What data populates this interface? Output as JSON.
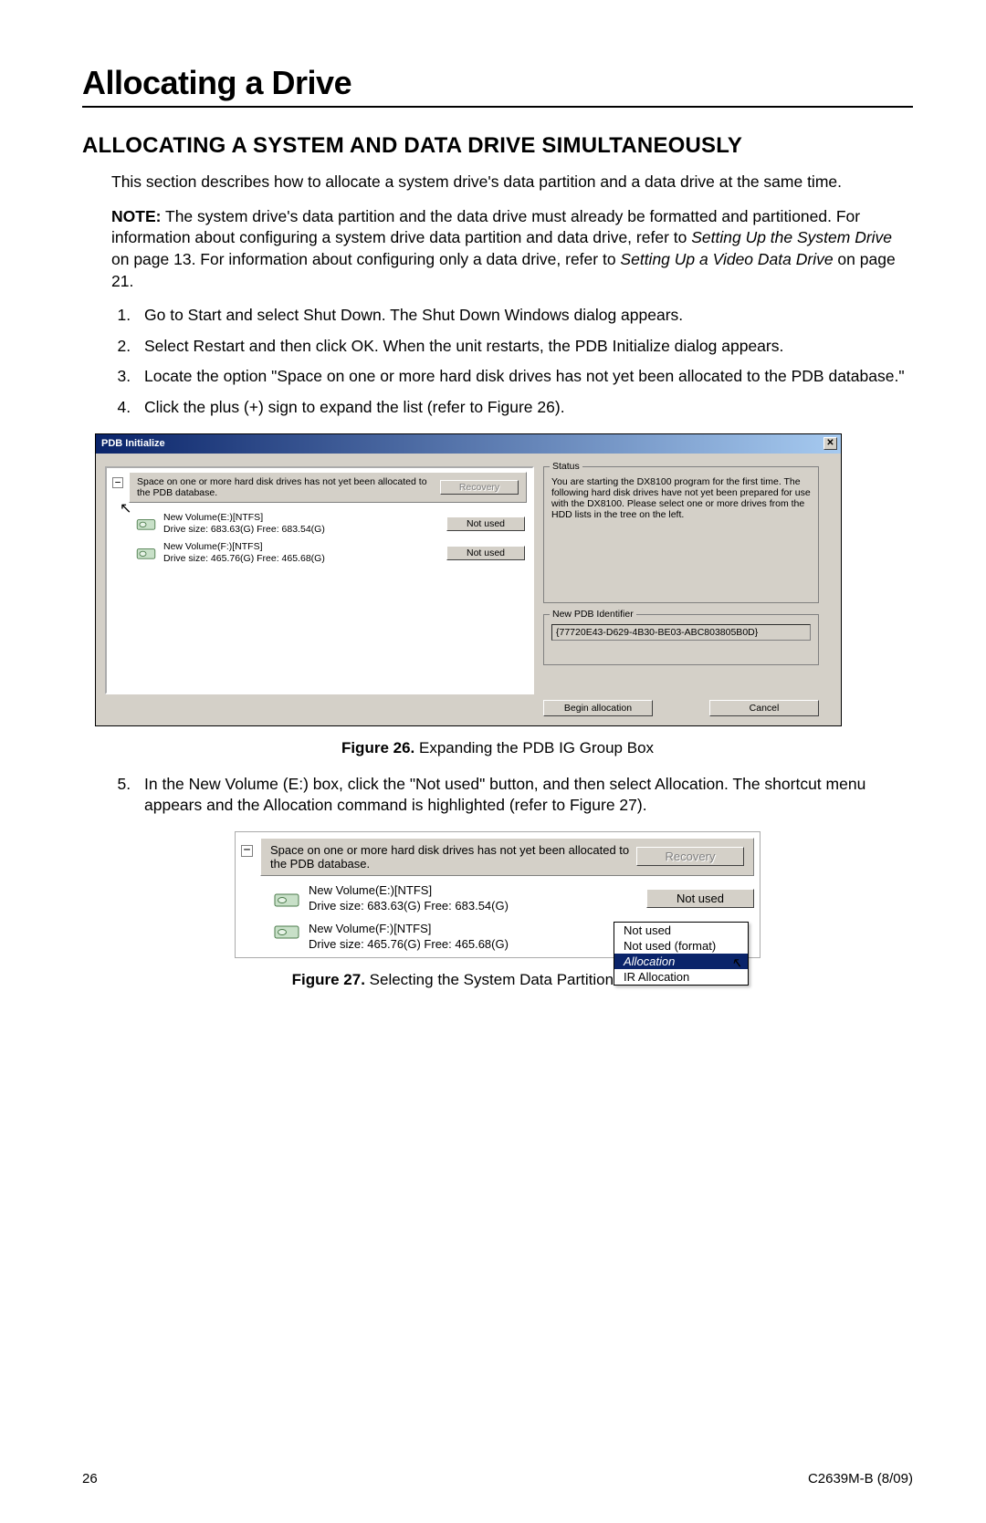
{
  "heading": "Allocating a Drive",
  "section": "ALLOCATING A SYSTEM AND DATA DRIVE SIMULTANEOUSLY",
  "intro": "This section describes how to allocate a system drive's data partition and a data drive at the same time.",
  "note_label": "NOTE:",
  "note_body_1": " The system drive's data partition and the data drive must already be formatted and partitioned. For information about configuring a system drive data partition and data drive, refer to ",
  "note_ref_1": "Setting Up the System Drive",
  "note_body_2": " on page 13. For information about configuring only a data drive, refer to ",
  "note_ref_2": "Setting Up a Video Data Drive",
  "note_body_3": " on page 21.",
  "steps": [
    "Go to Start and select Shut Down. The Shut Down Windows dialog appears.",
    "Select Restart and then click OK. When the unit restarts, the PDB Initialize dialog appears.",
    "Locate the option \"Space on one or more hard disk drives has not yet been allocated to the PDB database.\"",
    "Click the plus (+) sign to expand the list (refer to Figure 26)."
  ],
  "fig26": {
    "title": "PDB Initialize",
    "close_glyph": "✕",
    "collapse_glyph": "−",
    "head_text": "Space on one or more hard disk drives has not yet been allocated to the PDB database.",
    "recovery_btn": "Recovery",
    "notused_btn": "Not used",
    "drive1_name": "New Volume(E:)[NTFS]",
    "drive1_info": "Drive size: 683.63(G) Free: 683.54(G)",
    "drive2_name": "New Volume(F:)[NTFS]",
    "drive2_info": "Drive size: 465.76(G) Free: 465.68(G)",
    "status_label": "Status",
    "status_text": "You are starting the DX8100 program for the first time. The following hard disk drives have not yet been prepared for use with the DX8100. Please select one or more drives from the HDD lists in the tree on the left.",
    "pdb_label": "New PDB Identifier",
    "pdb_value": "{77720E43-D629-4B30-BE03-ABC803805B0D}",
    "begin_btn": "Begin allocation",
    "cancel_btn": "Cancel"
  },
  "fig26_caption_label": "Figure 26.",
  "fig26_caption_text": "  Expanding the PDB IG Group Box",
  "step5": "In the New Volume (E:) box, click the \"Not used\" button, and then select Allocation. The shortcut menu appears and the Allocation command is highlighted (refer to Figure 27).",
  "fig27": {
    "collapse_glyph": "−",
    "head_text": "Space on one or more hard disk drives has not yet been allocated to the PDB database.",
    "recovery_btn": "Recovery",
    "notused_btn": "Not used",
    "drive1_name": "New Volume(E:)[NTFS]",
    "drive1_info": "Drive size: 683.63(G) Free: 683.54(G)",
    "drive2_name": "New Volume(F:)[NTFS]",
    "drive2_info": "Drive size: 465.76(G) Free: 465.68(G)",
    "menu": {
      "opt1": "Not used",
      "opt2": "Not used (format)",
      "opt3": "Allocation",
      "opt4": "IR Allocation"
    }
  },
  "fig27_caption_label": "Figure 27.",
  "fig27_caption_text": "  Selecting the System Data Partition for Allocated",
  "footer_left": "26",
  "footer_right": "C2639M-B (8/09)"
}
